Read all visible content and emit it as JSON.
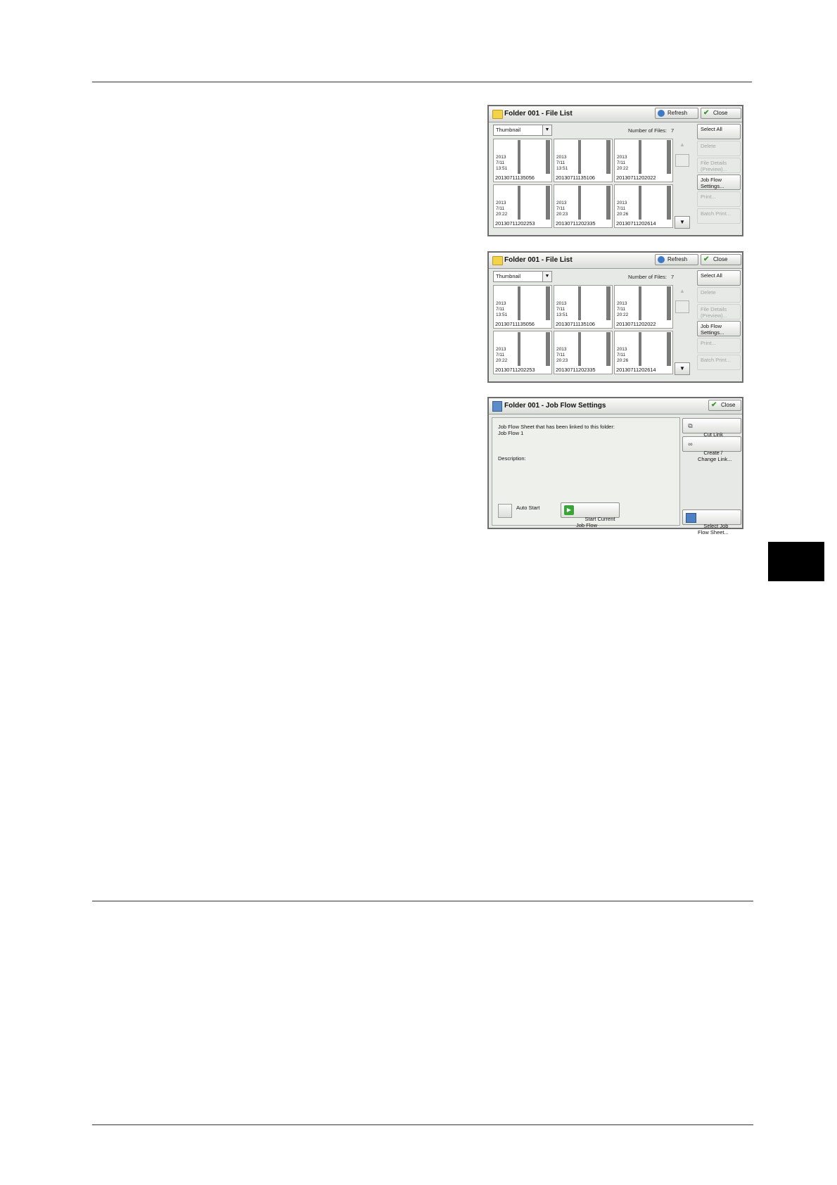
{
  "file_list_panels": [
    {
      "title": "Folder 001 - File List",
      "refresh_label": "Refresh",
      "close_label": "Close",
      "view_mode": "Thumbnail",
      "number_of_files_label": "Number of Files:",
      "number_of_files": "7",
      "files": [
        {
          "date": "2013\n7/11\n13:51",
          "name": "20130711135056"
        },
        {
          "date": "2013\n7/11\n13:51",
          "name": "20130711135106"
        },
        {
          "date": "2013\n7/11\n20:22",
          "name": "20130711202022"
        },
        {
          "date": "2013\n7/11\n20:22",
          "name": "20130711202253"
        },
        {
          "date": "2013\n7/11\n20:23",
          "name": "20130711202335"
        },
        {
          "date": "2013\n7/11\n20:26",
          "name": "20130711202614"
        }
      ],
      "side_buttons": [
        {
          "label": "Select All",
          "enabled": true
        },
        {
          "label": "Delete",
          "enabled": false
        },
        {
          "label": "File Details\n(Preview)...",
          "enabled": false
        },
        {
          "label": "Job Flow\nSettings...",
          "enabled": true
        },
        {
          "label": "Print...",
          "enabled": false
        },
        {
          "label": "Batch Print...",
          "enabled": false
        }
      ]
    },
    {
      "title": "Folder 001 - File List",
      "refresh_label": "Refresh",
      "close_label": "Close",
      "view_mode": "Thumbnail",
      "number_of_files_label": "Number of Files:",
      "number_of_files": "7",
      "files": [
        {
          "date": "2013\n7/11\n13:51",
          "name": "20130711135056"
        },
        {
          "date": "2013\n7/11\n13:51",
          "name": "20130711135106"
        },
        {
          "date": "2013\n7/11\n20:22",
          "name": "20130711202022"
        },
        {
          "date": "2013\n7/11\n20:22",
          "name": "20130711202253"
        },
        {
          "date": "2013\n7/11\n20:23",
          "name": "20130711202335"
        },
        {
          "date": "2013\n7/11\n20:26",
          "name": "20130711202614"
        }
      ],
      "side_buttons": [
        {
          "label": "Select All",
          "enabled": true
        },
        {
          "label": "Delete",
          "enabled": false
        },
        {
          "label": "File Details\n(Preview)...",
          "enabled": false
        },
        {
          "label": "Job Flow\nSettings...",
          "enabled": true
        },
        {
          "label": "Print...",
          "enabled": false
        },
        {
          "label": "Batch Print...",
          "enabled": false
        }
      ]
    }
  ],
  "job_flow_panel": {
    "title": "Folder 001 - Job Flow Settings",
    "close_label": "Close",
    "linked_sheet_label": "Job Flow Sheet that has been linked to this folder:",
    "linked_sheet_value": "Job Flow 1",
    "description_label": "Description:",
    "auto_start_label": "Auto Start",
    "start_button_label": "Start Current\nJob Flow",
    "cut_link_label": "Cut Link",
    "create_change_link_label": "Create /\nChange Link...",
    "select_sheet_label": "Select Job\nFlow Sheet..."
  }
}
